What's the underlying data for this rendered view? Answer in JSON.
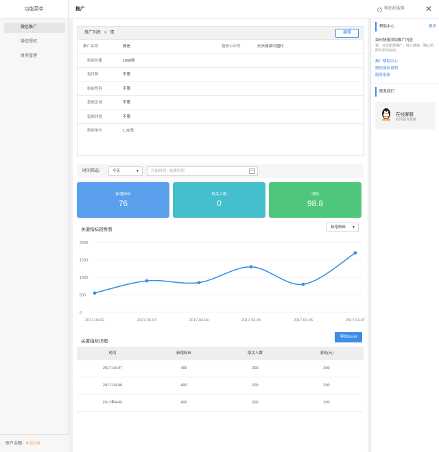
{
  "sidebar": {
    "title": "功能菜单",
    "items": [
      {
        "label": "微信推广",
        "active": true
      },
      {
        "label": "微信授权",
        "active": false
      },
      {
        "label": "财务管理",
        "active": false
      }
    ],
    "balance_label": "账户余额：",
    "balance_value": "¥ 20.00"
  },
  "header": {
    "title": "推广",
    "help_label": "帮助和服务",
    "help_icon": "question-circle-icon",
    "close_icon": "close-icon"
  },
  "detail": {
    "breadcrumb_parent": "推广列表",
    "breadcrumb_sep": ">",
    "breadcrumb_current": "情",
    "edit_label": "编辑",
    "rows": [
      {
        "label": "推广名称",
        "value": "微信",
        "label2": "投放公众号",
        "value2": "天天阅读中国村"
      },
      {
        "label": "粉丝总量",
        "value": "1000粉"
      },
      {
        "label": "每日数",
        "value": "不限"
      },
      {
        "label": "粉丝性别",
        "value": "不限"
      },
      {
        "label": "投放区域",
        "value": "不限"
      },
      {
        "label": "投放时段",
        "value": "不限"
      },
      {
        "label": "粉丝单价",
        "value": "1.30元"
      }
    ]
  },
  "filter": {
    "label": "时间筛选：",
    "period_value": "今天",
    "date_placeholder": "开始时间 - 结束时间",
    "calendar_icon": "calendar-icon"
  },
  "cards": [
    {
      "label": "新增粉丝",
      "value": "76",
      "color": "#5aa0ec"
    },
    {
      "label": "取关人数",
      "value": "0",
      "color": "#45bfcb"
    },
    {
      "label": "消耗",
      "value": "98.8",
      "color": "#4fc77a"
    }
  ],
  "trend": {
    "title": "关键指标趋势图",
    "metric_value": "新增粉丝"
  },
  "chart_data": {
    "type": "line",
    "x": [
      "2017-04-02",
      "2017-04-03",
      "2017-04-04",
      "2017-04-05",
      "2017-04-06",
      "2017-04-07"
    ],
    "series": [
      {
        "values": [
          550,
          900,
          850,
          1300,
          800,
          1700
        ],
        "color": "#3b8ee6"
      }
    ],
    "y_ticks": [
      0,
      500,
      1000,
      1500,
      2000
    ],
    "ylim": [
      0,
      2000
    ],
    "grid": true,
    "smooth": true
  },
  "table": {
    "title": "关键指标详细",
    "export_label": "导出Excel",
    "headers": [
      "时间",
      "新增粉丝",
      "取关人数",
      "消耗(元)"
    ],
    "rows": [
      [
        "2017-04-07",
        "400",
        "200",
        "200"
      ],
      [
        "2017-04-06",
        "400",
        "200",
        "200"
      ],
      [
        "2017年4-05",
        "400",
        "200",
        "200"
      ]
    ]
  },
  "help_panel": {
    "section1_title": "帮助中心",
    "more_label": "更多",
    "question": "如何快速添加推广内容",
    "answer": "答：点击新建推广，输入链接，确认后即可添加完成。",
    "links": [
      "推广帮助中心",
      "微信授权说明",
      "服务条款"
    ],
    "section2_title": "联系我们",
    "service_title": "在线客服",
    "service_sub": "有问题点我哦",
    "service_icon": "qq-penguin-icon"
  }
}
